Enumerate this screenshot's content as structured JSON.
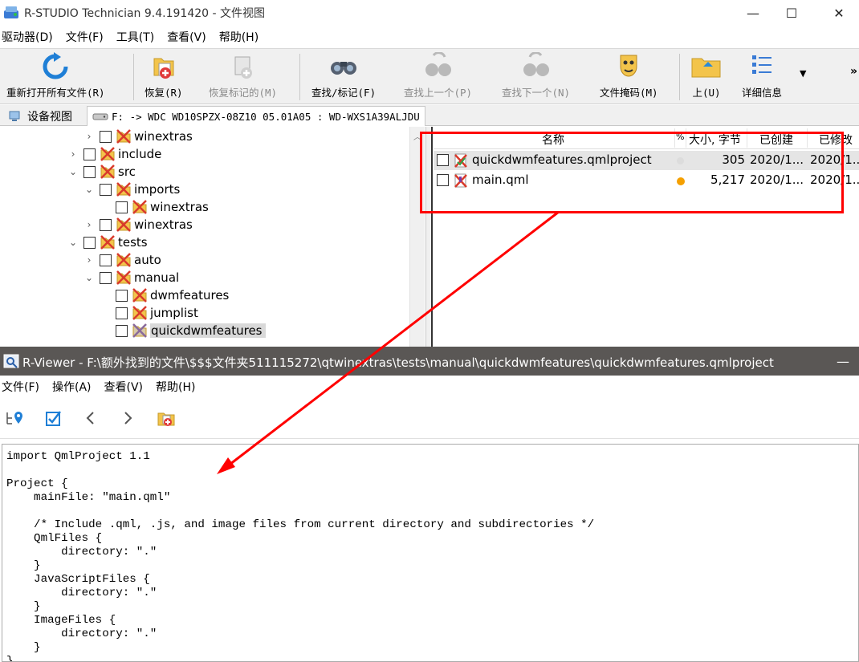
{
  "app": {
    "title": "R-STUDIO Technician 9.4.191420 - 文件视图",
    "window_controls": {
      "minimize": "—",
      "maximize": "☐",
      "close": "✕"
    }
  },
  "menu": [
    "驱动器(D)",
    "文件(F)",
    "工具(T)",
    "查看(V)",
    "帮助(H)"
  ],
  "toolbar": {
    "reopen": "重新打开所有文件(R)",
    "recover": "恢复(R)",
    "recover_marked": "恢复标记的(M)",
    "find_mark": "查找/标记(F)",
    "find_prev": "查找上一个(P)",
    "find_next": "查找下一个(N)",
    "file_mask": "文件掩码(M)",
    "up": "上(U)",
    "details": "详细信息",
    "more": "»"
  },
  "tabs": {
    "device_view": "设备视图",
    "drive": "F: -> WDC WD10SPZX-08Z10 05.01A05 : WD-WXS1A39ALJDU"
  },
  "tree": [
    {
      "label": "winextras",
      "indent": 2,
      "expander": "›"
    },
    {
      "label": "include",
      "indent": 1,
      "expander": "›"
    },
    {
      "label": "src",
      "indent": 1,
      "expander": "⌄"
    },
    {
      "label": "imports",
      "indent": 2,
      "expander": "⌄"
    },
    {
      "label": "winextras",
      "indent": 3,
      "expander": ""
    },
    {
      "label": "winextras",
      "indent": 2,
      "expander": "›"
    },
    {
      "label": "tests",
      "indent": 1,
      "expander": "⌄"
    },
    {
      "label": "auto",
      "indent": 2,
      "expander": "›"
    },
    {
      "label": "manual",
      "indent": 2,
      "expander": "⌄"
    },
    {
      "label": "dwmfeatures",
      "indent": 3,
      "expander": ""
    },
    {
      "label": "jumplist",
      "indent": 3,
      "expander": ""
    },
    {
      "label": "quickdwmfeatures",
      "indent": 3,
      "expander": "",
      "selected": true
    }
  ],
  "filelist": {
    "columns": {
      "name": "名称",
      "flag": "%",
      "size": "大小, 字节",
      "created": "已创建",
      "modified": "已修改"
    },
    "rows": [
      {
        "name": "quickdwmfeatures.qmlproject",
        "size": "305",
        "created": "2020/1...",
        "modified": "2020/1...",
        "status_color": "#dcdcdc"
      },
      {
        "name": "main.qml",
        "size": "5,217",
        "created": "2020/1...",
        "modified": "2020/1...",
        "status_color": "#f5a000"
      }
    ]
  },
  "viewer": {
    "title": "R-Viewer - F:\\额外找到的文件\\$$$文件夹511115272\\qtwinextras\\tests\\manual\\quickdwmfeatures\\quickdwmfeatures.qmlproject",
    "minimize": "—",
    "menu": [
      "文件(F)",
      "操作(A)",
      "查看(V)",
      "帮助(H)"
    ],
    "code": "import QmlProject 1.1\n\nProject {\n    mainFile: \"main.qml\"\n\n    /* Include .qml, .js, and image files from current directory and subdirectories */\n    QmlFiles {\n        directory: \".\"\n    }\n    JavaScriptFiles {\n        directory: \".\"\n    }\n    ImageFiles {\n        directory: \".\"\n    }\n}"
  },
  "colors": {
    "annotation": "#ff0000",
    "viewer_titlebar": "#5a5755",
    "selection": "#d9d9d9"
  }
}
